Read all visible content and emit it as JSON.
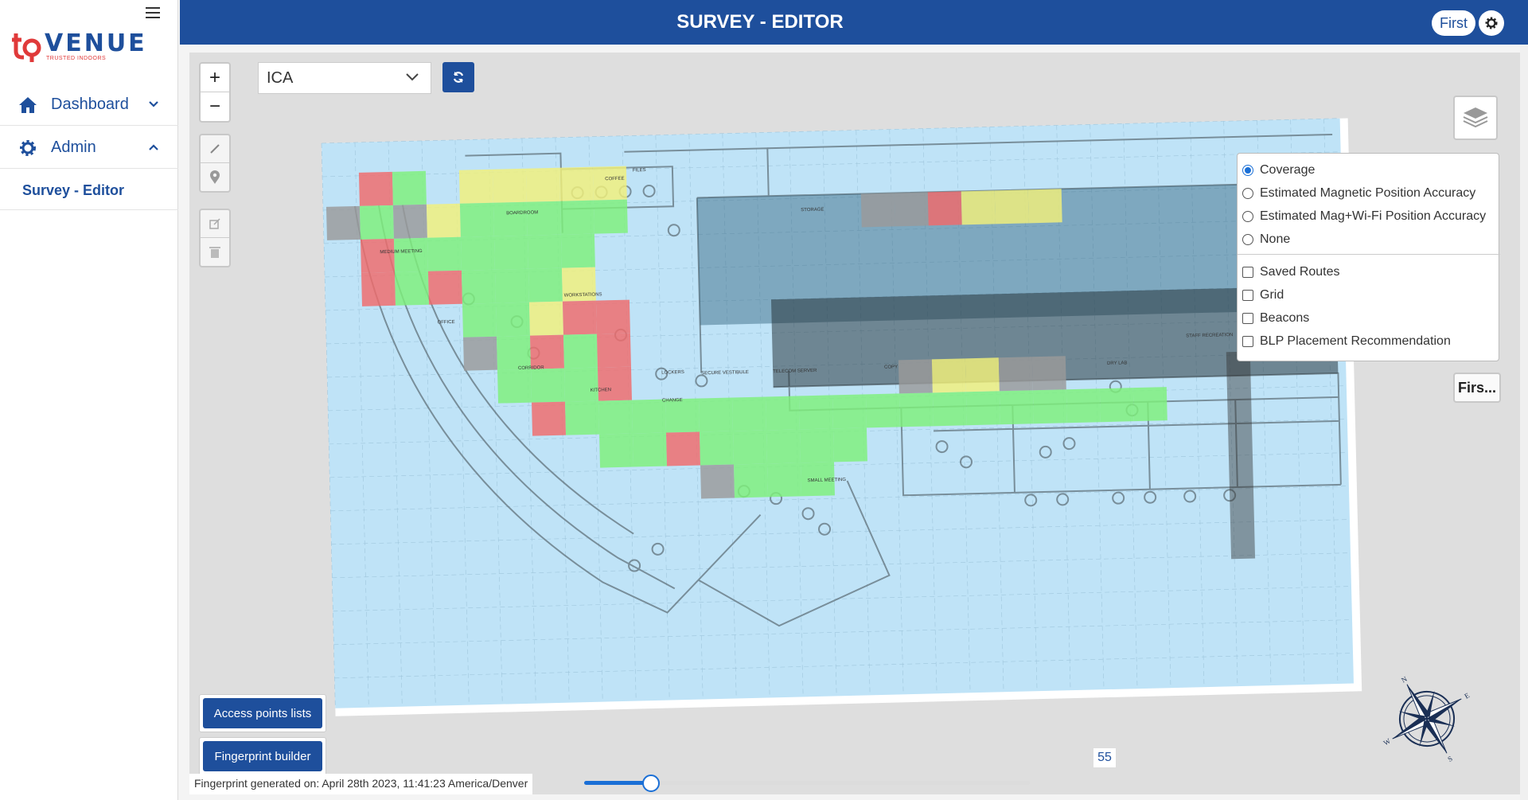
{
  "brand": {
    "name": "VENUE",
    "tagline": "TRUSTED INDOORS"
  },
  "sidebar": {
    "items": [
      {
        "label": "Dashboard",
        "icon": "home-icon",
        "expanded": false
      },
      {
        "label": "Admin",
        "icon": "gear-icon",
        "expanded": true
      }
    ],
    "active_sub": "Survey - Editor"
  },
  "header": {
    "title": "SURVEY - EDITOR",
    "user": "First"
  },
  "map": {
    "venue_select": "ICA",
    "layers": {
      "modes": [
        {
          "label": "Coverage",
          "selected": true
        },
        {
          "label": "Estimated Magnetic Position Accuracy",
          "selected": false
        },
        {
          "label": "Estimated Mag+Wi-Fi Position Accuracy",
          "selected": false
        },
        {
          "label": "None",
          "selected": false
        }
      ],
      "overlays": [
        {
          "label": "Saved Routes",
          "checked": false
        },
        {
          "label": "Grid",
          "checked": false
        },
        {
          "label": "Beacons",
          "checked": false
        },
        {
          "label": "BLP Placement Recommendation",
          "checked": false
        }
      ]
    },
    "floor_button": "Firs...",
    "controls": {
      "access_points": "Access points lists",
      "fingerprint_builder": "Fingerprint builder"
    },
    "fingerprint_note": "Fingerprint generated on: April 28th 2023, 11:41:23 America/Denver",
    "slider": {
      "value": 55,
      "fraction": 0.15
    },
    "compass": {
      "n": "N",
      "e": "E",
      "s": "S",
      "w": "W"
    },
    "room_labels": [
      "BOARDROOM",
      "COFFEE",
      "FILES",
      "STORAGE",
      "MEDIUM MEETING",
      "OFFICE",
      "WORKSTATIONS",
      "CORRIDOR",
      "KITCHEN",
      "LOCKERS",
      "SECURE VESTIBULE",
      "TELECOM SERVER",
      "COPY",
      "DRY LAB",
      "STAFF RECREATION",
      "SMALL MEETING",
      "CHANGE"
    ],
    "colors": {
      "good": "#7ef07a",
      "fair": "#f2f07a",
      "poor": "#f06a6a",
      "none": "#9a9a9a",
      "area": "#bfe3f7"
    }
  }
}
